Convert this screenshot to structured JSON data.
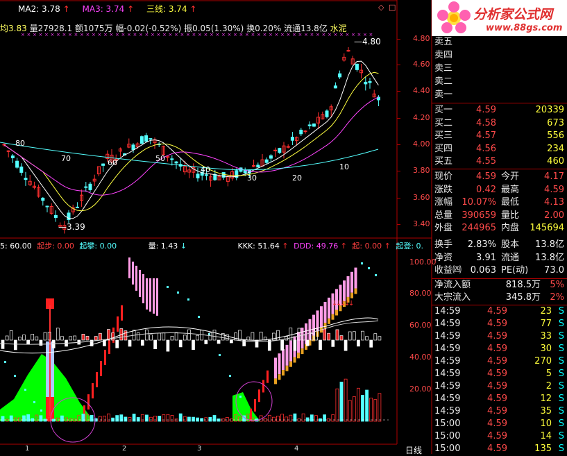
{
  "header": {
    "ma1": "均3.83",
    "vol": "量27928.1",
    "amount": "额1075万",
    "change": "幅-0.02(-0.52%)",
    "amp": "振0.05(1.30%)",
    "turnover": "换0.20%",
    "float": "流通13.8亿",
    "name": "水泥",
    "ma2": "MA2: 3.78",
    "ma3": "MA3: 3.74",
    "line3": "三线: 3.74"
  },
  "price_axis": [
    "4.80",
    "4.60",
    "4.40",
    "4.20",
    "4.00",
    "3.80",
    "3.60",
    "3.40"
  ],
  "indicator_axis": [
    "100.00",
    "80.00",
    "60.00",
    "40.00",
    "20.00"
  ],
  "price_labels": {
    "high": "4.80",
    "low": "3.39",
    "m80": "80",
    "m70": "70",
    "m60": "60",
    "m50": "50",
    "m40": "40",
    "m30": "30",
    "m20": "20",
    "m10": "10"
  },
  "indicator_header": {
    "a": "5: 60.00",
    "qibu": "起步: 0.00",
    "qipan": "起攀: 0.00",
    "liang": "量: 1.43",
    "kkk": "KKK: 51.64",
    "ddd": "DDD: 49.76",
    "qi": "起: 0.00",
    "qideng": "起登: 0."
  },
  "x_labels": [
    "1",
    "2",
    "3",
    "4"
  ],
  "period": "日线",
  "logo": {
    "title": "分析家公式网",
    "url": "www.88gs.com"
  },
  "sell_rows": [
    {
      "label": "卖五"
    },
    {
      "label": "卖四"
    },
    {
      "label": "卖三"
    },
    {
      "label": "卖二"
    },
    {
      "label": "卖一"
    }
  ],
  "buy_rows": [
    {
      "label": "买一",
      "price": "4.59",
      "vol": "20339"
    },
    {
      "label": "买二",
      "price": "4.58",
      "vol": "673"
    },
    {
      "label": "买三",
      "price": "4.57",
      "vol": "556"
    },
    {
      "label": "买四",
      "price": "4.56",
      "vol": "234"
    },
    {
      "label": "买五",
      "price": "4.55",
      "vol": "460"
    }
  ],
  "stats": [
    {
      "k1": "现价",
      "v1": "4.59",
      "k2": "今开",
      "v2": "4.17"
    },
    {
      "k1": "涨跌",
      "v1": "0.42",
      "k2": "最高",
      "v2": "4.59"
    },
    {
      "k1": "涨幅",
      "v1": "10.07%",
      "k2": "最低",
      "v2": "4.13"
    },
    {
      "k1": "总量",
      "v1": "390659",
      "k2": "量比",
      "v2": "2.00"
    },
    {
      "k1": "外盘",
      "v1": "244965",
      "k2": "内盘",
      "v2": "145694"
    }
  ],
  "info": [
    {
      "k1": "换手",
      "v1": "2.83%",
      "k2": "股本",
      "v2": "13.8亿"
    },
    {
      "k1": "净资",
      "v1": "3.91",
      "k2": "流通",
      "v2": "13.8亿"
    },
    {
      "k1": "收益㈣",
      "v1": "0.063",
      "k2": "PE(动)",
      "v2": "73.0"
    }
  ],
  "flows": [
    {
      "k": "净流入额",
      "v": "818.5万",
      "p": "5%"
    },
    {
      "k": "大宗流入",
      "v": "345.8万",
      "p": "2%"
    }
  ],
  "ticks": [
    {
      "t": "14:59",
      "p": "4.59",
      "v": "23",
      "s": "S"
    },
    {
      "t": "14:59",
      "p": "4.59",
      "v": "77",
      "s": "S"
    },
    {
      "t": "14:59",
      "p": "4.59",
      "v": "33",
      "s": "S"
    },
    {
      "t": "14:59",
      "p": "4.59",
      "v": "30",
      "s": "S"
    },
    {
      "t": "14:59",
      "p": "4.59",
      "v": "270",
      "s": "S"
    },
    {
      "t": "14:59",
      "p": "4.59",
      "v": "5",
      "s": "S"
    },
    {
      "t": "14:59",
      "p": "4.59",
      "v": "2",
      "s": "S"
    },
    {
      "t": "14:59",
      "p": "4.59",
      "v": "12",
      "s": "S"
    },
    {
      "t": "14:59",
      "p": "4.59",
      "v": "35",
      "s": "S"
    },
    {
      "t": "15:00",
      "p": "4.59",
      "v": "10",
      "s": "S"
    },
    {
      "t": "15:00",
      "p": "4.59",
      "v": "14",
      "s": "S"
    },
    {
      "t": "15:00",
      "p": "4.59",
      "v": "135",
      "s": "S"
    }
  ],
  "colors": {
    "up": "#ff3030",
    "down": "#54ffff",
    "grid": "#a00000",
    "pink": "#ff9ce6",
    "orange": "#e8a020",
    "green": "#00ff00"
  }
}
